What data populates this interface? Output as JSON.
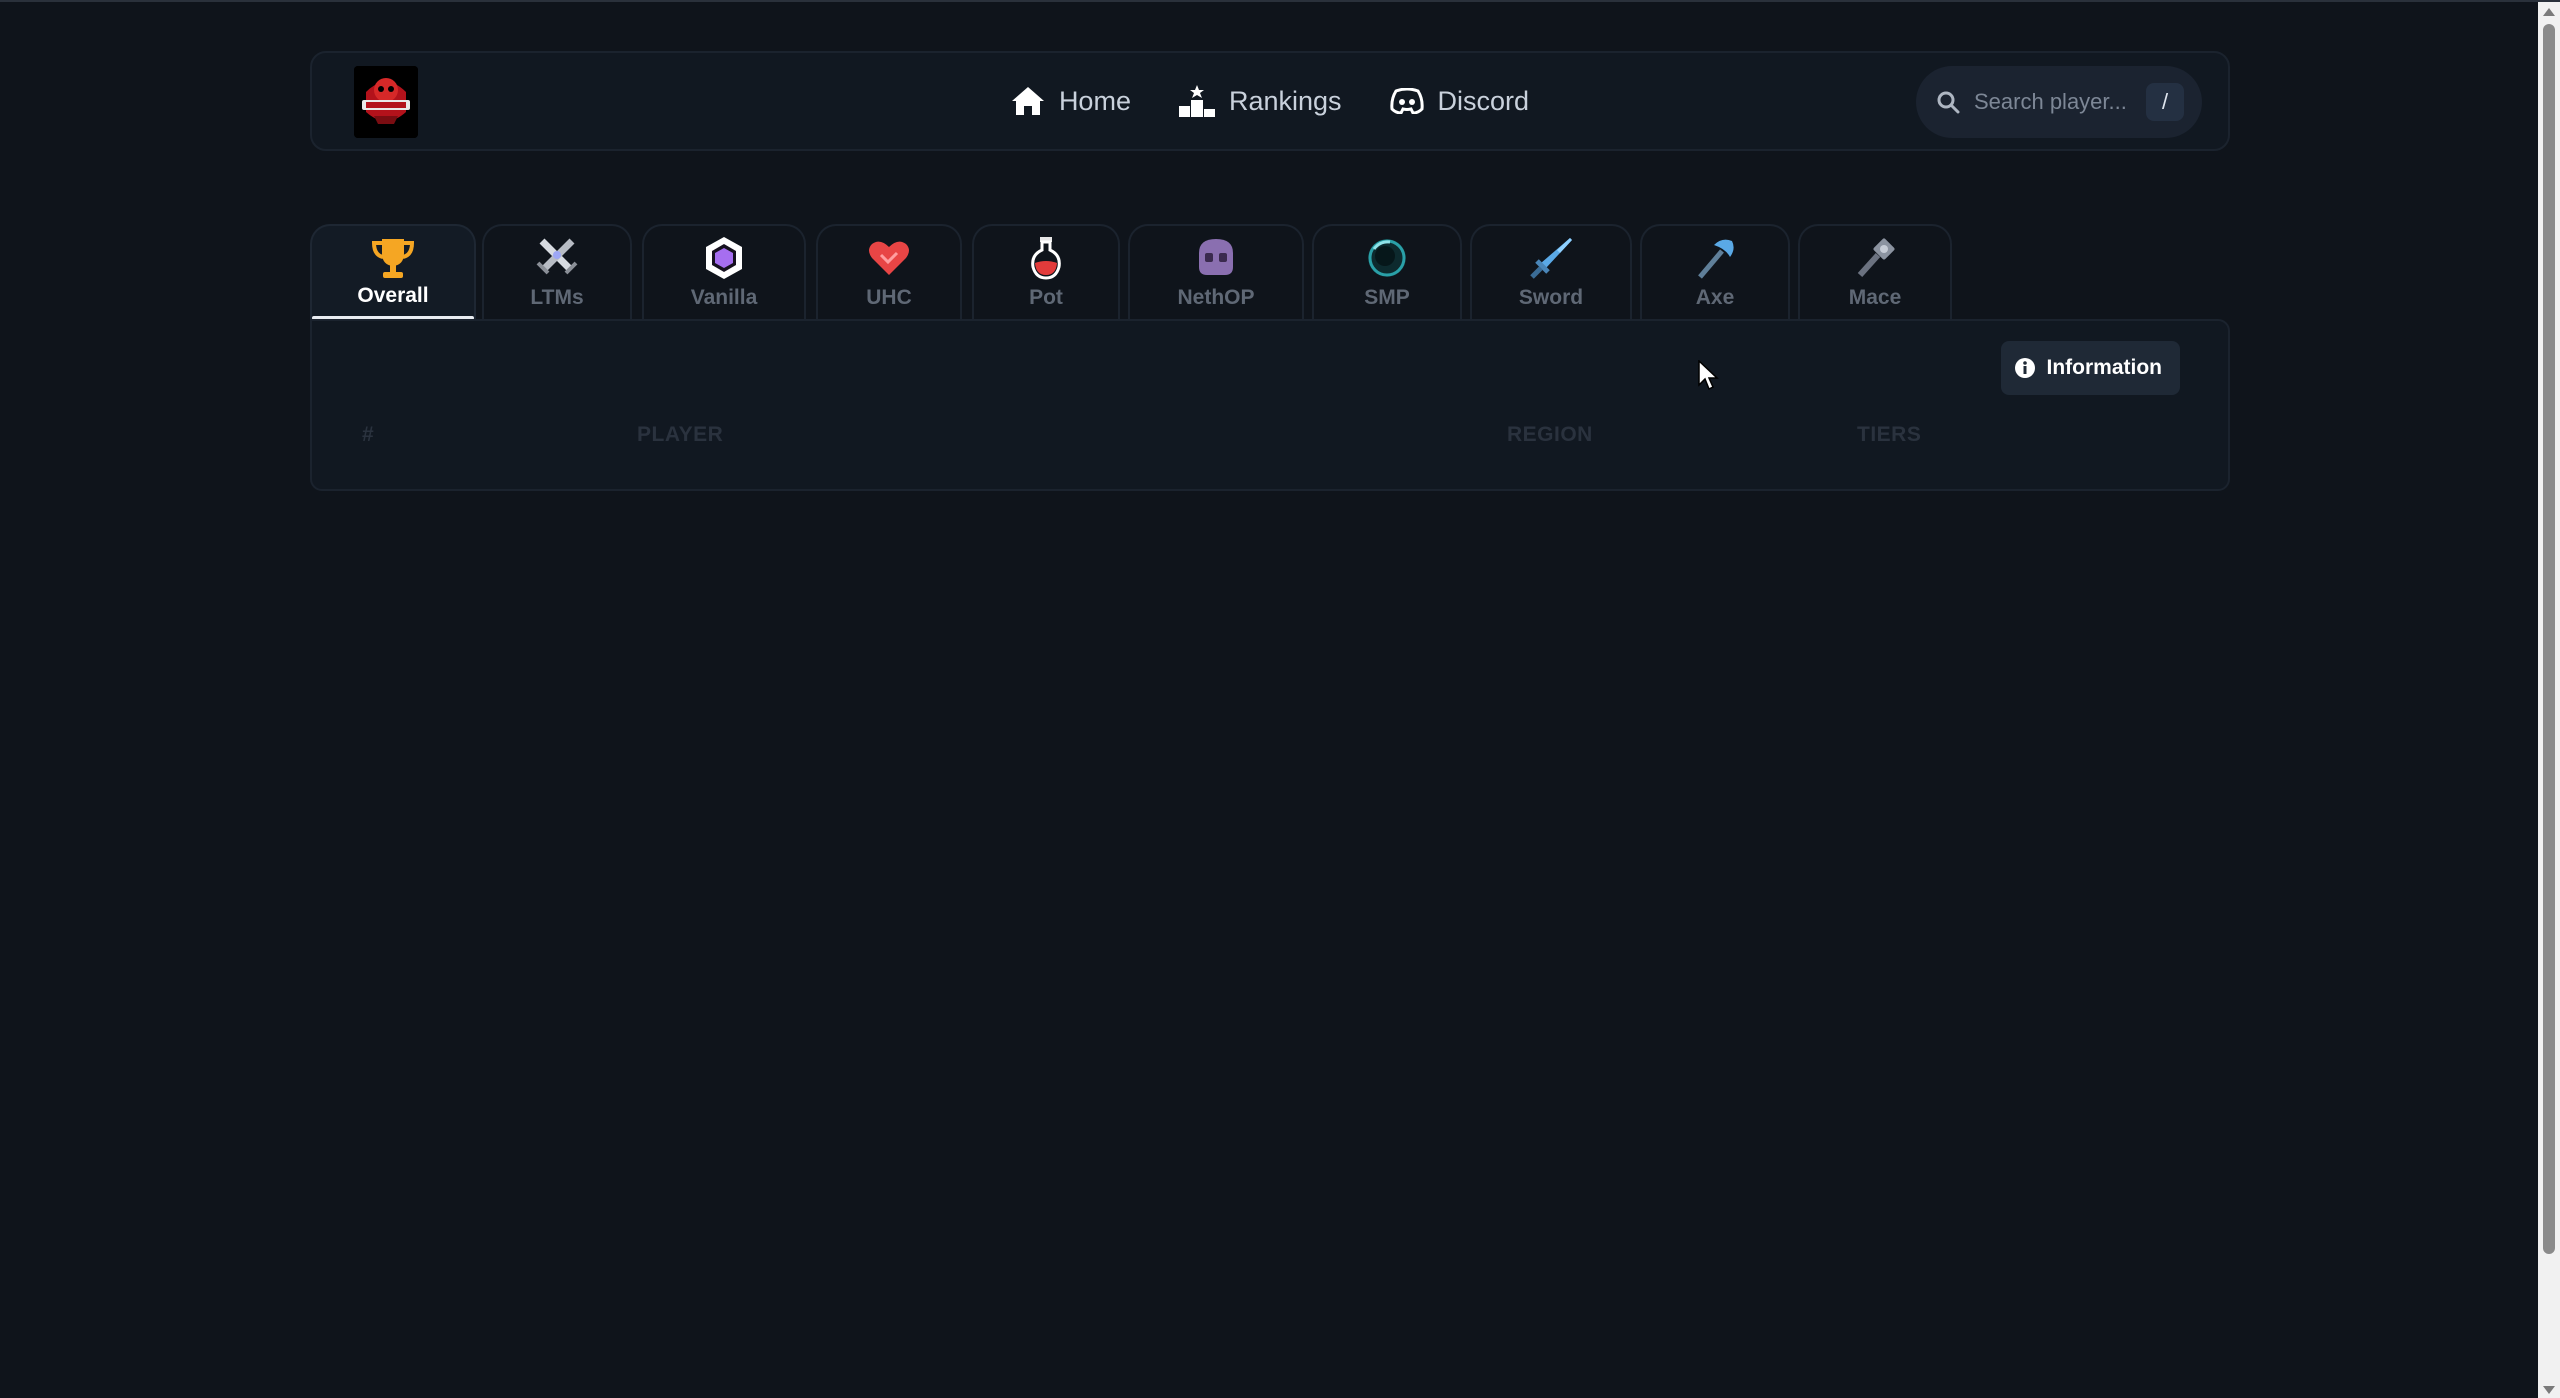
{
  "nav": {
    "links": [
      {
        "label": "Home",
        "icon": "home-icon"
      },
      {
        "label": "Rankings",
        "icon": "podium-icon"
      },
      {
        "label": "Discord",
        "icon": "discord-icon"
      }
    ],
    "logo_icon": "deathroyal-logo",
    "search": {
      "placeholder": "Search player...",
      "value": "",
      "shortcut": "/"
    }
  },
  "tabs": [
    {
      "label": "Overall",
      "icon": "trophy-icon",
      "active": true
    },
    {
      "label": "LTMs",
      "icon": "crossed-swords-icon"
    },
    {
      "label": "Vanilla",
      "icon": "crystal-icon"
    },
    {
      "label": "UHC",
      "icon": "heart-icon"
    },
    {
      "label": "Pot",
      "icon": "potion-icon"
    },
    {
      "label": "NethOP",
      "icon": "skull-icon"
    },
    {
      "label": "SMP",
      "icon": "ender-pearl-icon"
    },
    {
      "label": "Sword",
      "icon": "sword-icon"
    },
    {
      "label": "Axe",
      "icon": "axe-icon"
    },
    {
      "label": "Mace",
      "icon": "mace-icon"
    }
  ],
  "panel": {
    "info_button": "Information",
    "columns": {
      "rank": "#",
      "player": "PLAYER",
      "region": "REGION",
      "tiers": "TIERS"
    }
  },
  "colors": {
    "background": "#0f141b",
    "surface": "#111821",
    "border": "#1b232e",
    "trophy": "#f5a623",
    "uhc_heart": "#e84545",
    "vanilla_purple": "#a66ef0",
    "sword_blue": "#5aa9e6"
  }
}
